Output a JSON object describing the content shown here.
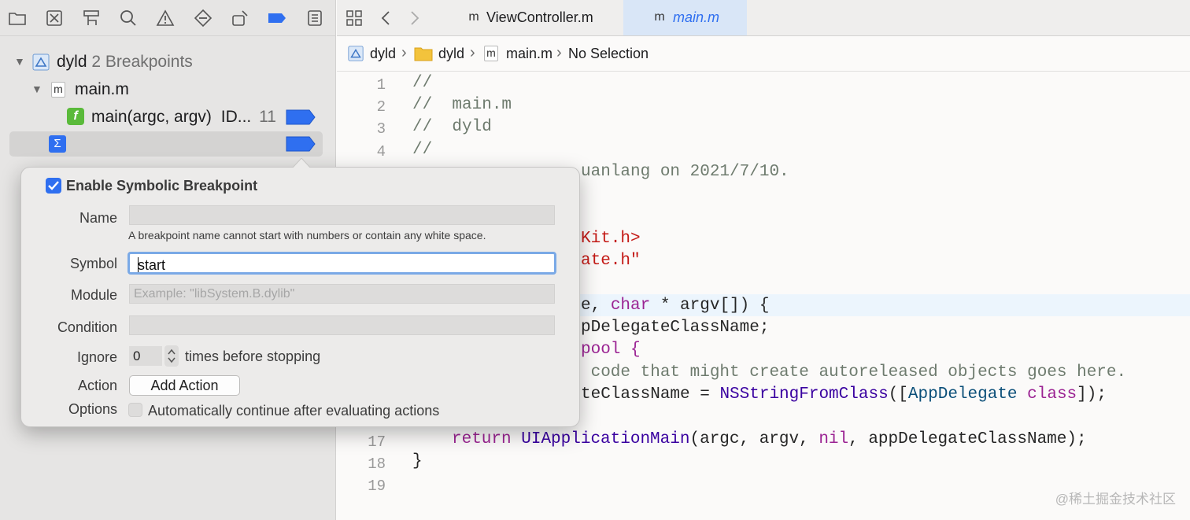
{
  "navigator": {
    "project": {
      "name": "dyld",
      "count_text": "2 Breakpoints"
    },
    "file": {
      "name": "main.m",
      "icon_letter": "m"
    },
    "breakpoint_function": {
      "icon_letter": "f",
      "label": "main(argc, argv)",
      "id_text": "ID...",
      "line": "11"
    },
    "symbolic_icon_letter": "Σ"
  },
  "tabs": [
    {
      "icon_letter": "m",
      "label": "ViewController.m"
    },
    {
      "icon_letter": "m",
      "label": "main.m"
    }
  ],
  "jumpbar": [
    "dyld",
    "dyld",
    "main.m",
    "No Selection"
  ],
  "gutter": [
    "1",
    "2",
    "3",
    "4",
    "17",
    "18",
    "19"
  ],
  "code": {
    "l1": "//",
    "l2": "//  main.m",
    "l3": "//  dyld",
    "l4": "//",
    "l5_tail": "uanlang on 2021/7/10.",
    "l8_tail": "Kit.h>",
    "l9_tail": "ate.h\"",
    "l11_a": "e, ",
    "l11_kw": "char",
    "l11_b": " * argv[]) {",
    "l12": "pDelegateClassName;",
    "l13": "pool {",
    "l14": " code that might create autoreleased objects goes here.",
    "l15_a": "teClassName = ",
    "l15_fn": "NSStringFromClass",
    "l15_b": "([",
    "l15_cls": "AppDelegate",
    "l15_sp": " ",
    "l15_kw": "class",
    "l15_c": "]);",
    "l17_kw": "return",
    "l17_fn": "UIApplicationMain",
    "l17_a": "(argc, argv, ",
    "l17_nil": "nil",
    "l17_b": ", appDelegateClassName);",
    "l18": "}"
  },
  "popover": {
    "enable_label": "Enable Symbolic Breakpoint",
    "enabled": true,
    "name_label": "Name",
    "name_value": "",
    "name_hint": "A breakpoint name cannot start with numbers or contain any white space.",
    "symbol_label": "Symbol",
    "symbol_value": "start",
    "module_label": "Module",
    "module_placeholder": "Example: \"libSystem.B.dylib\"",
    "condition_label": "Condition",
    "ignore_label": "Ignore",
    "ignore_value": "0",
    "ignore_suffix": "times before stopping",
    "action_label": "Action",
    "add_action_label": "Add Action",
    "options_label": "Options",
    "auto_continue_label": "Automatically continue after evaluating actions",
    "auto_continue": false
  },
  "watermark": "@稀土掘金技术社区",
  "icons": [
    "folder-icon",
    "source-control-icon",
    "symbol-navigator-icon",
    "search-icon",
    "warning-icon",
    "test-diamond-icon",
    "debug-navigator-icon",
    "breakpoint-navigator-icon",
    "report-icon",
    "grid-icon",
    "back-icon",
    "forward-icon"
  ],
  "colors": {
    "accent": "#2f6ff0",
    "breakpoint": "#2f6ff0",
    "checkbox": "#2f6ff0"
  }
}
